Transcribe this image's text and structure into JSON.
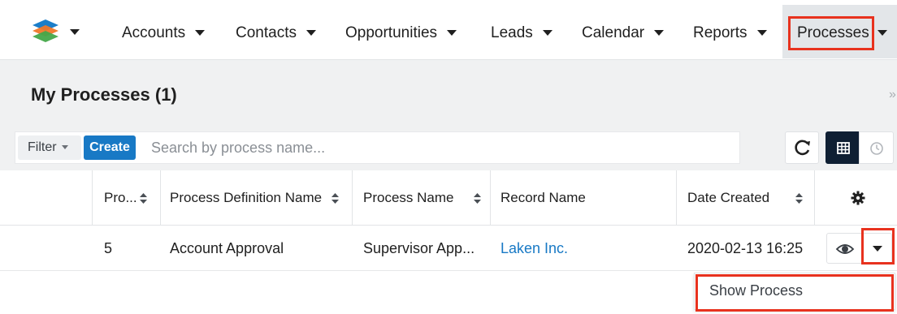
{
  "nav": {
    "items": [
      {
        "label": "Accounts"
      },
      {
        "label": "Contacts"
      },
      {
        "label": "Opportunities"
      },
      {
        "label": "Leads"
      },
      {
        "label": "Calendar"
      },
      {
        "label": "Reports"
      },
      {
        "label": "Processes"
      }
    ],
    "active": "Processes",
    "logo_icon": "layers-logo-icon"
  },
  "page": {
    "title": "My Processes (1)",
    "collapse_glyph": "»"
  },
  "toolbar": {
    "filter_label": "Filter",
    "create_label": "Create",
    "search_placeholder": "Search by process name..."
  },
  "table": {
    "columns": [
      "Pro...",
      "Process Definition Name",
      "Process Name",
      "Record Name",
      "Date Created"
    ],
    "rows": [
      {
        "id": "5",
        "definition": "Account Approval",
        "process_name": "Supervisor App...",
        "record": "Laken Inc.",
        "date": "2020-02-13 16:25"
      }
    ]
  },
  "row_menu": {
    "items": [
      {
        "label": "Show Process"
      }
    ]
  },
  "colors": {
    "accent": "#1879c5",
    "highlight": "#e8321e",
    "active_view": "#0f1f33"
  }
}
